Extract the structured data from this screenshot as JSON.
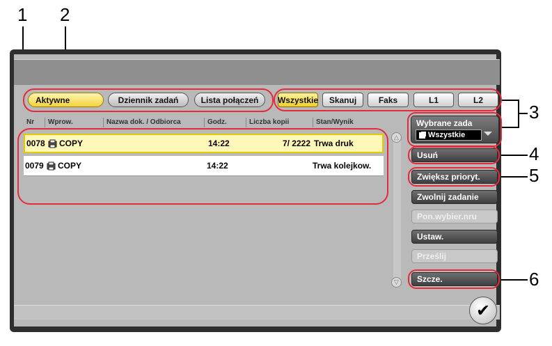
{
  "callouts": {
    "c1": "1",
    "c2": "2",
    "c3": "3",
    "c4": "4",
    "c5": "5",
    "c6": "6"
  },
  "tabs": {
    "active": "Aktywne",
    "log": "Dziennik zadań",
    "connections": "Lista połączeń"
  },
  "filters": {
    "all": "Wszystkie",
    "scan": "Skanuj",
    "fax": "Faks",
    "l1": "L1",
    "l2": "L2"
  },
  "columns": {
    "nr": "Nr",
    "input": "Wprow.",
    "name": "Nazwa dok. / Odbiorca",
    "time": "Godz.",
    "copies": "Liczba kopii",
    "status": "Stan/Wynik"
  },
  "rows": [
    {
      "nr": "0078",
      "input": "COPY",
      "name": "",
      "time": "14:22",
      "copies": "7/ 2222",
      "status": "Trwa druk",
      "selected": true
    },
    {
      "nr": "0079",
      "input": "COPY",
      "name": "",
      "time": "14:22",
      "copies": "",
      "status": "Trwa kolejkow.",
      "selected": false
    }
  ],
  "side": {
    "selected_jobs_label": "Wybrane zada",
    "selected_jobs_value": "Wszystkie",
    "delete": "Usuń",
    "raise_priority": "Zwiększ prioryt.",
    "release_job": "Zwolnij zadanie",
    "dest_recall": "Pon.wybier.nru",
    "settings": "Ustaw.",
    "send": "Prześlij",
    "details": "Szcze."
  },
  "colors": {
    "highlight": "#e52a3a",
    "active_tab": "#f3d23e",
    "selected_row": "#fff8b8"
  },
  "icons": {
    "ok": "check-icon",
    "copy": "copy-job-icon",
    "scroll_up": "scroll-up-icon",
    "scroll_down": "scroll-down-icon"
  }
}
